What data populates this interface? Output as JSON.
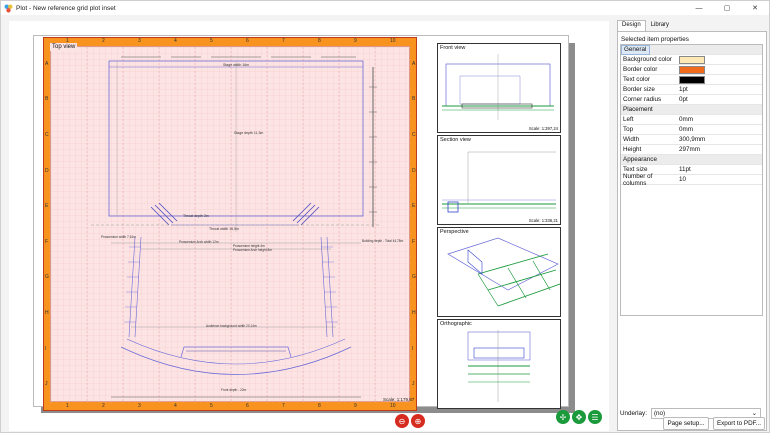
{
  "window": {
    "title": "Plot - New reference grid plot inset",
    "minimize": "—",
    "maximize": "▢",
    "close": "✕"
  },
  "ruler": {
    "columns": [
      "1",
      "2",
      "3",
      "4",
      "5",
      "6",
      "7",
      "8",
      "9",
      "10"
    ],
    "rows": [
      "A",
      "B",
      "C",
      "D",
      "E",
      "F",
      "G",
      "H",
      "I",
      "J"
    ]
  },
  "main_view": {
    "title": "Top view",
    "scale": "Scale: 1:179,87",
    "labels": {
      "stage_width": "Stage width 16m",
      "stage_depth": "Stage depth 11,3m",
      "throat_depth": "Throat depth 3m",
      "throat_width": "Throat width 16,5m",
      "proscenium_width": "Proscenium width 7,61m",
      "arch_width": "Proscenium Arch width 12m",
      "arch_height": "Proscenium height 4m",
      "arch_height2": "Proscenium Arch height 8m",
      "building_depth": "Building depth - Total 44,78m",
      "audience_width": "Audience background width 20,14m",
      "front_depth": "Front depth - 22m"
    }
  },
  "insets": [
    {
      "title": "Front view",
      "scale": "Scale: 1:397,24"
    },
    {
      "title": "Section view",
      "scale": "Scale: 1:336,21"
    },
    {
      "title": "Perspective",
      "scale": ""
    },
    {
      "title": "Orthographic",
      "scale": ""
    }
  ],
  "panel": {
    "tabs": [
      "Design",
      "Library"
    ],
    "properties_title": "Selected item properties",
    "sections": {
      "general": "General",
      "placement": "Placement",
      "appearance": "Appearance"
    },
    "props": {
      "background_color": {
        "label": "Background color",
        "color": "#fde9b5"
      },
      "border_color": {
        "label": "Border color",
        "color": "#f26b1d"
      },
      "text_color": {
        "label": "Text color",
        "color": "#000000"
      },
      "border_size": {
        "label": "Border size",
        "value": "1pt"
      },
      "corner_radius": {
        "label": "Corner radius",
        "value": "0pt"
      },
      "left": {
        "label": "Left",
        "value": "0mm"
      },
      "top": {
        "label": "Top",
        "value": "0mm"
      },
      "width": {
        "label": "Width",
        "value": "300,9mm"
      },
      "height": {
        "label": "Height",
        "value": "297mm"
      },
      "text_size": {
        "label": "Text size",
        "value": "11pt"
      },
      "columns": {
        "label": "Number of columns",
        "value": "10"
      }
    },
    "underlay_label": "Underlay:",
    "underlay_value": "(no)",
    "page_setup": "Page setup...",
    "export_pdf": "Export to PDF..."
  },
  "colors": {
    "ruler": "#f7931e",
    "plot_bg": "#fde4e4",
    "accent_green": "#1a9a3b",
    "accent_red": "#d62b1f"
  }
}
